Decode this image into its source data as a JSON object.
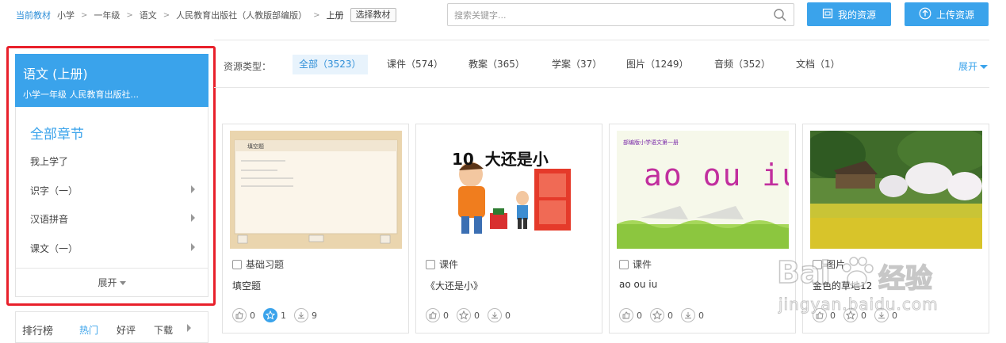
{
  "breadcrumb": {
    "current_label": "当前教材",
    "items": [
      "小学",
      "一年级",
      "语文",
      "人民教育出版社（人教版部编版）",
      "上册"
    ],
    "separator": ">",
    "pick_button": "选择教材"
  },
  "search": {
    "placeholder": "搜索关键字..."
  },
  "header_buttons": {
    "my_resources": "我的资源",
    "upload": "上传资源"
  },
  "sidebar": {
    "title": "语文 (上册)",
    "subtitle": "小学一年级    人民教育出版社...",
    "all_chapters": "全部章节",
    "items": [
      {
        "label": "我上学了",
        "has_arrow": false
      },
      {
        "label": "识字（一）",
        "has_arrow": true
      },
      {
        "label": "汉语拼音",
        "has_arrow": true
      },
      {
        "label": "课文（一）",
        "has_arrow": true
      }
    ],
    "expand": "展开"
  },
  "ranking": {
    "title": "排行榜",
    "tabs": [
      "热门",
      "好评",
      "下载"
    ]
  },
  "filter": {
    "label": "资源类型：",
    "tabs": [
      "全部（3523）",
      "课件（574）",
      "教案（365）",
      "学案（37）",
      "图片（1249）",
      "音频（352）",
      "文档（1）"
    ],
    "active_index": 0,
    "expand": "展开"
  },
  "cards": [
    {
      "type": "基础习题",
      "title": "填空题",
      "likes": "0",
      "favorites": "1",
      "downloads": "9",
      "favorite_active": true,
      "thumb_heading": "填空题"
    },
    {
      "type": "课件",
      "title": "《大还是小》",
      "likes": "0",
      "favorites": "0",
      "downloads": "0",
      "favorite_active": false,
      "thumb_heading": "10  大还是小"
    },
    {
      "type": "课件",
      "title": "ao ou iu",
      "likes": "0",
      "favorites": "0",
      "downloads": "0",
      "favorite_active": false,
      "thumb_heading": "部编版小学语文第一册",
      "thumb_letters": "ao ou iu"
    },
    {
      "type": "图片",
      "title": "金色的草地12",
      "likes": "0",
      "favorites": "0",
      "downloads": "0",
      "favorite_active": false
    }
  ],
  "watermark": {
    "text1": "Bai",
    "text2": "经验",
    "url": "jingyan.baidu.com"
  },
  "colors": {
    "accent": "#3aa3eb",
    "highlight_border": "#e8202b"
  }
}
